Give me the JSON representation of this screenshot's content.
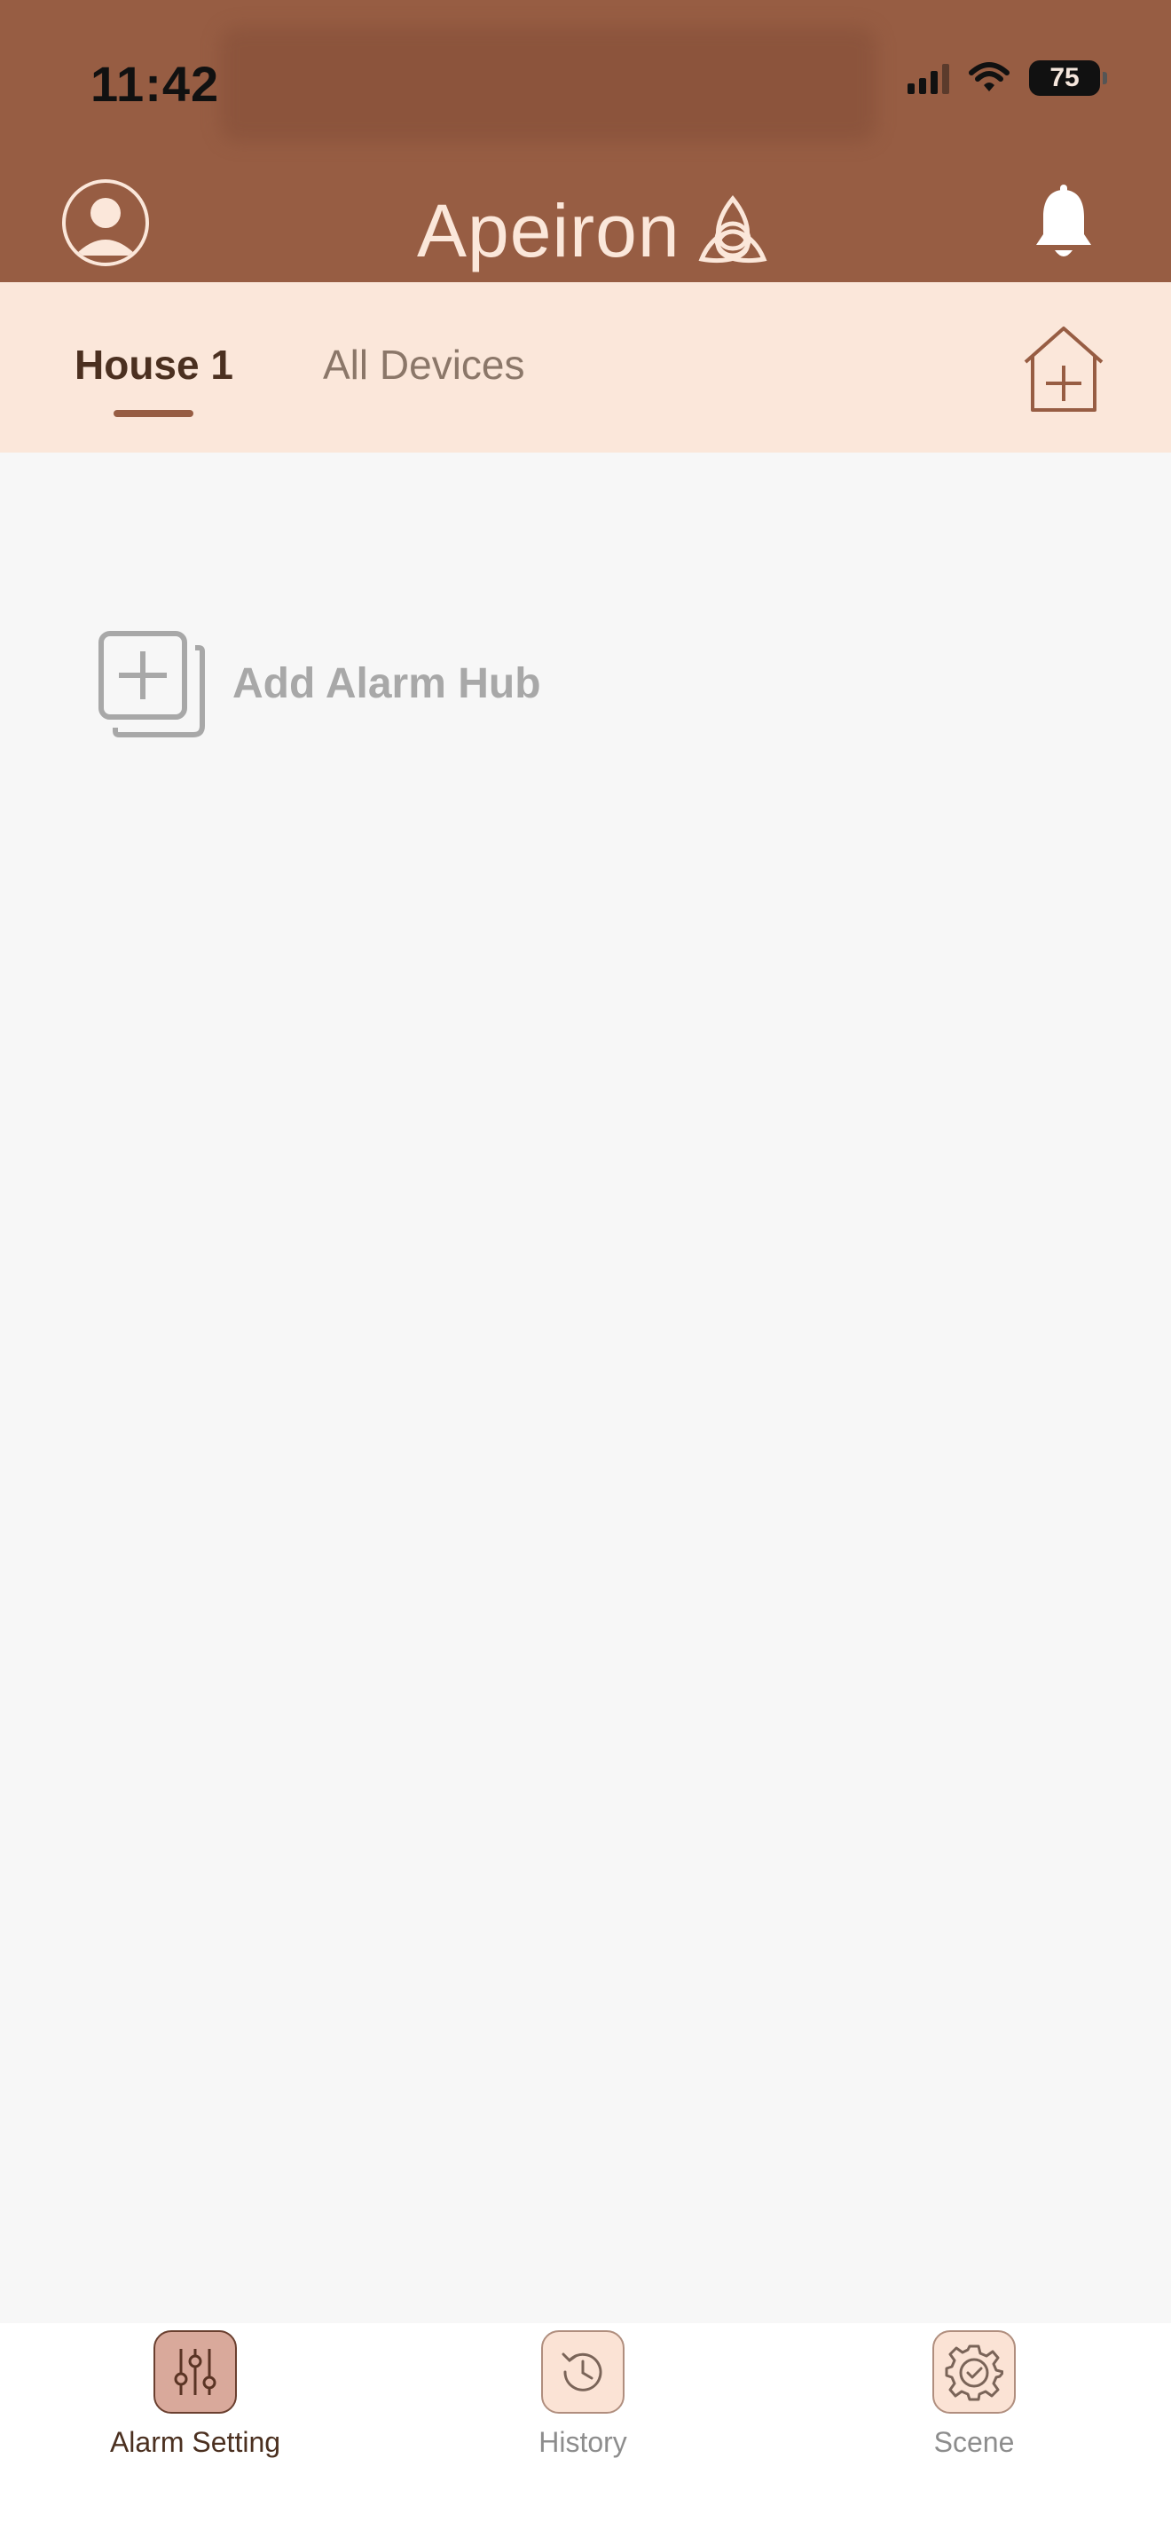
{
  "status_bar": {
    "time": "11:42",
    "battery": "75"
  },
  "header": {
    "app_name": "Apeiron"
  },
  "tabs": [
    {
      "label": "House 1",
      "active": true
    },
    {
      "label": "All Devices",
      "active": false
    }
  ],
  "content": {
    "add_hub_label": "Add Alarm Hub"
  },
  "bottom_nav": [
    {
      "label": "Alarm Setting",
      "icon": "sliders-icon",
      "active": true
    },
    {
      "label": "History",
      "icon": "history-icon",
      "active": false
    },
    {
      "label": "Scene",
      "icon": "gear-check-icon",
      "active": false
    }
  ],
  "colors": {
    "header_bg": "#975d43",
    "tab_bar_bg": "#fbe7da",
    "content_bg": "#f7f7f7",
    "accent": "#975d43"
  }
}
